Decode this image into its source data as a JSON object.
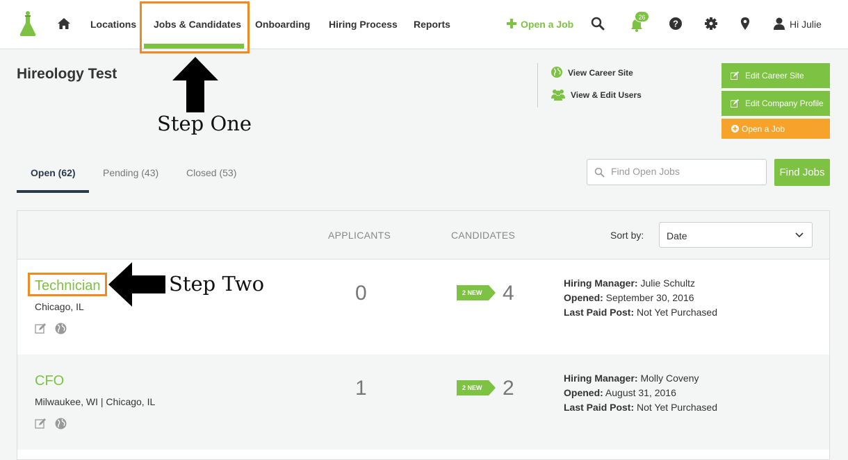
{
  "nav": {
    "items": [
      {
        "label": "Locations"
      },
      {
        "label": "Jobs & Candidates"
      },
      {
        "label": "Onboarding"
      },
      {
        "label": "Hiring Process"
      },
      {
        "label": "Reports"
      }
    ],
    "open_job": "Open a Job",
    "notifications_count": "26",
    "greeting": "Hi Julie"
  },
  "annotations": {
    "step_one": "Step One",
    "step_two": "Step Two"
  },
  "header": {
    "company": "Hireology Test",
    "links": {
      "career_site": "View Career Site",
      "users": "View & Edit Users"
    },
    "buttons": {
      "edit_career_site": "Edit Career Site",
      "edit_company_profile": "Edit Company Profile",
      "open_job": "Open a Job"
    }
  },
  "tabs": [
    {
      "label": "Open (62)"
    },
    {
      "label": "Pending (43)"
    },
    {
      "label": "Closed (53)"
    }
  ],
  "search": {
    "placeholder": "Find Open Jobs",
    "button": "Find Jobs"
  },
  "table": {
    "headers": {
      "applicants": "APPLICANTS",
      "candidates": "CANDIDATES"
    },
    "sort_label": "Sort by:",
    "sort_value": "Date",
    "rows": [
      {
        "title": "Technician",
        "location": "Chicago, IL",
        "applicants": "0",
        "new_badge": "2 NEW",
        "candidates": "4",
        "hiring_manager_label": "Hiring Manager:",
        "hiring_manager": "Julie Schultz",
        "opened_label": "Opened:",
        "opened": "September 30, 2016",
        "last_paid_label": "Last Paid Post:",
        "last_paid": "Not Yet Purchased"
      },
      {
        "title": "CFO",
        "location": "Milwaukee, WI | Chicago, IL",
        "applicants": "1",
        "new_badge": "2 NEW",
        "candidates": "2",
        "hiring_manager_label": "Hiring Manager:",
        "hiring_manager": "Molly Coveny",
        "opened_label": "Opened:",
        "opened": "August 31, 2016",
        "last_paid_label": "Last Paid Post:",
        "last_paid": "Not Yet Purchased"
      }
    ]
  },
  "colors": {
    "brand_green": "#7dc242",
    "accent_orange": "#f5a32a",
    "annotation_orange": "#f08a1e",
    "tab_active": "#2b3a4a"
  }
}
